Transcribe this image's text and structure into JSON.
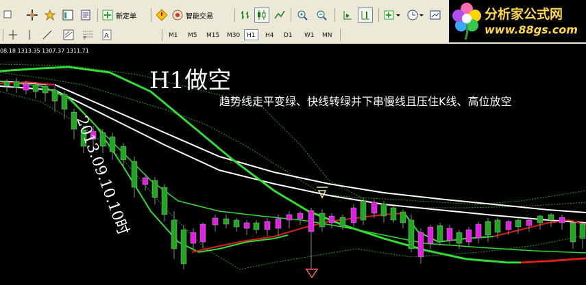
{
  "toolbar_main": {
    "new_order_label": "新定单",
    "expert_label": "智能交易"
  },
  "toolbar_periods": [
    "M1",
    "M5",
    "M15",
    "M30",
    "H1",
    "H4",
    "D1",
    "W1",
    "MN"
  ],
  "active_period": "H1",
  "logo": {
    "title": "分析家公式网",
    "url": "www.88gs.com"
  },
  "chart": {
    "quote_line": "08.18 1313.35 1307.37 1311.71",
    "annotation_title": "H1做空",
    "annotation_text": "趋势线走平变绿、快线转绿并下串慢线且压住K线、高位放空",
    "annotation_date": "2013.09.10.10时"
  },
  "colors": {
    "background": "#000000",
    "bull_candle": "#22a522",
    "bear_candle": "#e020e0",
    "fast_line": "#dd1d1d",
    "trend_line_green": "#33dd33",
    "slow_line": "#ffffff",
    "band_line": "#2aa02a"
  },
  "icons": [
    "crosshair-icon",
    "zoom-in-icon",
    "zoom-out-icon",
    "bar-chart-icon",
    "candle-chart-icon",
    "line-chart-icon",
    "indicators-icon",
    "clock-icon",
    "template-icon",
    "arrow-down-icon",
    "arrow-up-icon"
  ]
}
